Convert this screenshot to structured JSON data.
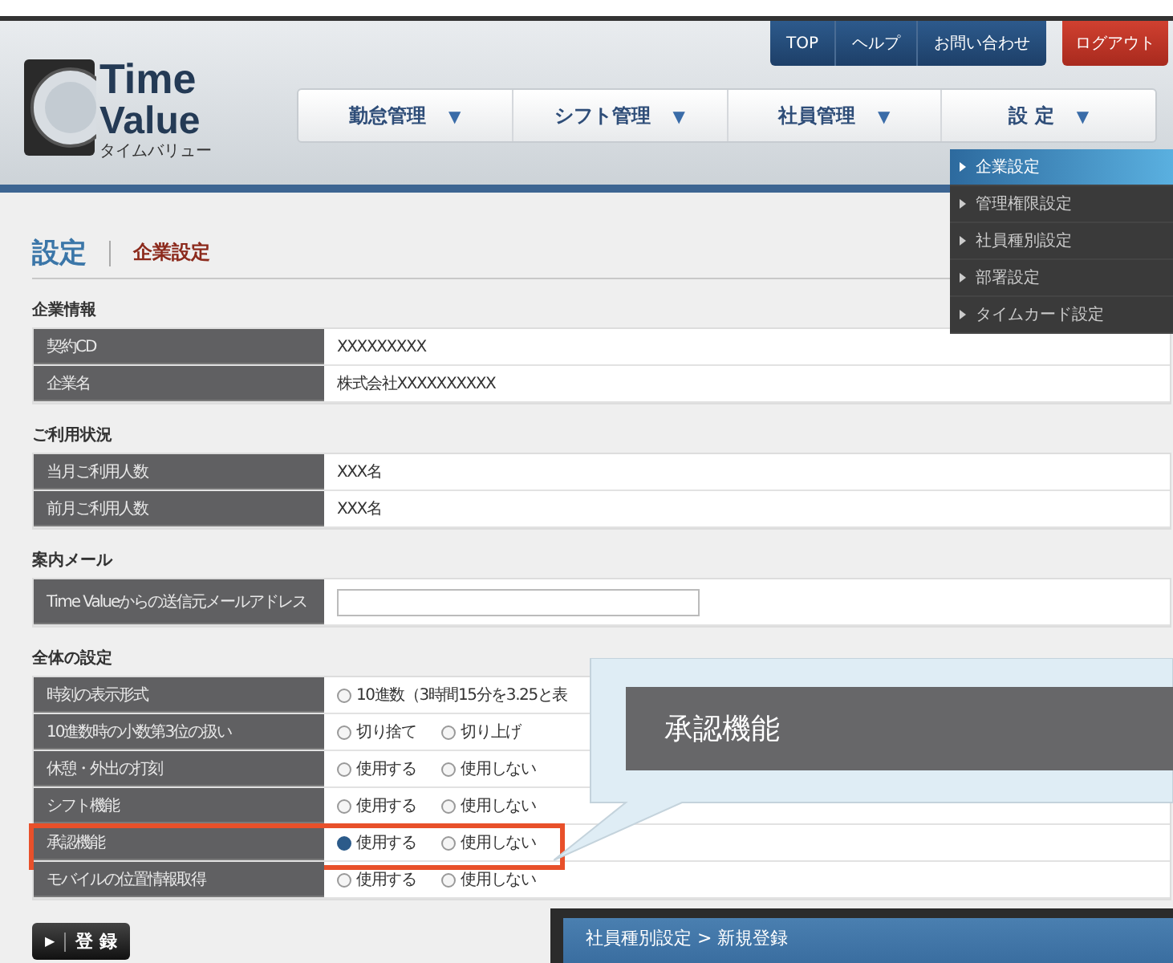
{
  "logo": {
    "line1": "Time",
    "line2": "Value",
    "kana": "タイムバリュー"
  },
  "top_links": [
    {
      "label": "TOP"
    },
    {
      "label": "ヘルプ"
    },
    {
      "label": "お問い合わせ"
    }
  ],
  "logout": "ログアウト",
  "nav": [
    {
      "label": "勤怠管理",
      "arrow": "▼"
    },
    {
      "label": "シフト管理",
      "arrow": "▼"
    },
    {
      "label": "社員管理",
      "arrow": "▼"
    },
    {
      "label": "設 定",
      "arrow": "▼"
    }
  ],
  "dropdown": [
    {
      "label": "企業設定",
      "selected": true
    },
    {
      "label": "管理権限設定",
      "selected": false
    },
    {
      "label": "社員種別設定",
      "selected": false
    },
    {
      "label": "部署設定",
      "selected": false
    },
    {
      "label": "タイムカード設定",
      "selected": false
    }
  ],
  "page_title": "設定",
  "breadcrumb": "企業設定",
  "sections": [
    {
      "title": "企業情報",
      "rows": [
        {
          "kind": "text",
          "label": "契約CD",
          "value": "XXXXXXXXX",
          "highlighted": false
        },
        {
          "kind": "text",
          "label": "企業名",
          "value": "株式会社XXXXXXXXXX",
          "highlighted": false
        }
      ]
    },
    {
      "title": "ご利用状況",
      "rows": [
        {
          "kind": "text",
          "label": "当月ご利用人数",
          "value": "XXX名",
          "highlighted": false
        },
        {
          "kind": "text",
          "label": "前月ご利用人数",
          "value": "XXX名",
          "highlighted": false
        }
      ]
    },
    {
      "title": "案内メール",
      "rows": [
        {
          "kind": "input",
          "label": "Time Valueからの送信元メールアドレス",
          "highlighted": false
        }
      ]
    },
    {
      "title": "全体の設定",
      "rows": [
        {
          "kind": "radio",
          "label": "時刻の表示形式",
          "highlighted": false,
          "options": [
            {
              "label": "10進数（3時間15分を3.25と表",
              "selected": false
            }
          ]
        },
        {
          "kind": "radio",
          "label": "10進数時の小数第3位の扱い",
          "highlighted": false,
          "options": [
            {
              "label": "切り捨て",
              "selected": false
            },
            {
              "label": "切り上げ",
              "selected": false
            }
          ]
        },
        {
          "kind": "radio",
          "label": "休憩・外出の打刻",
          "highlighted": false,
          "options": [
            {
              "label": "使用する",
              "selected": false
            },
            {
              "label": "使用しない",
              "selected": false
            }
          ]
        },
        {
          "kind": "radio",
          "label": "シフト機能",
          "highlighted": false,
          "options": [
            {
              "label": "使用する",
              "selected": false
            },
            {
              "label": "使用しない",
              "selected": false
            }
          ]
        },
        {
          "kind": "radio",
          "label": "承認機能",
          "highlighted": true,
          "options": [
            {
              "label": "使用する",
              "selected": true
            },
            {
              "label": "使用しない",
              "selected": false
            }
          ]
        },
        {
          "kind": "radio",
          "label": "モバイルの位置情報取得",
          "highlighted": false,
          "options": [
            {
              "label": "使用する",
              "selected": false
            },
            {
              "label": "使用しない",
              "selected": false
            }
          ]
        }
      ]
    }
  ],
  "register_button": {
    "icon": "▶",
    "label": "登 録"
  },
  "callout": {
    "title": "承認機能"
  },
  "dialog": {
    "title": "社員種別設定 > 新規登録"
  }
}
